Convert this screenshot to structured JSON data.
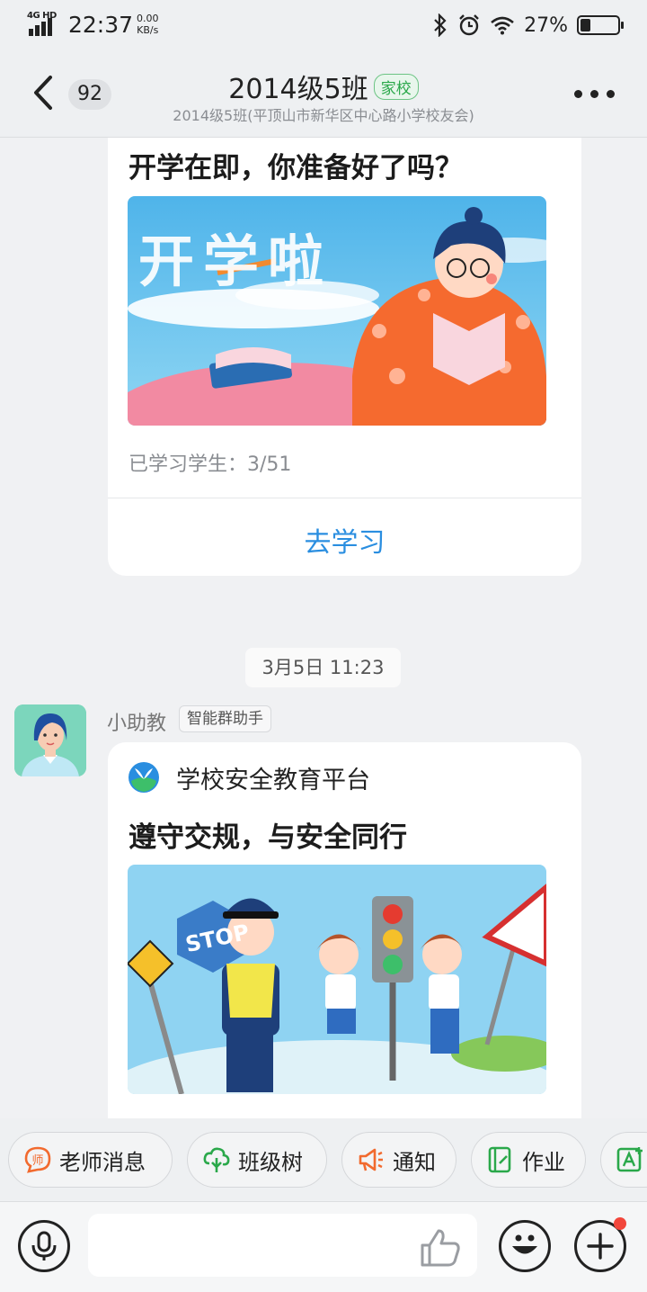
{
  "status_bar": {
    "network": "4G HD",
    "time": "22:37",
    "speed_value": "0.00",
    "speed_unit": "KB/s",
    "battery_percent": "27%",
    "battery_level": 0.27
  },
  "header": {
    "unread_count": "92",
    "title": "2014级5班",
    "title_tag": "家校",
    "subtitle": "2014级5班(平顶山市新华区中心路小学校友会)"
  },
  "messages": {
    "card1": {
      "title": "开学在即，你准备好了吗？",
      "image_text": "开学啦",
      "progress_label": "已学习学生：3/51",
      "action": "去学习"
    },
    "time_divider": "3月5日 11:23",
    "card2": {
      "sender": "小助教",
      "sender_tag": "智能群助手",
      "platform": "学校安全教育平台",
      "title": "遵守交规，与安全同行",
      "image_text": "STOP"
    }
  },
  "shortcuts": [
    {
      "label": "老师消息",
      "icon": "teacher-icon",
      "color": "#f26a2e"
    },
    {
      "label": "班级树",
      "icon": "tree-icon",
      "color": "#2aa84a"
    },
    {
      "label": "通知",
      "icon": "megaphone-icon",
      "color": "#f26a2e"
    },
    {
      "label": "作业",
      "icon": "homework-icon",
      "color": "#2aa84a"
    },
    {
      "label": "",
      "icon": "text-add-icon",
      "color": "#2aa84a"
    }
  ],
  "input": {
    "placeholder": ""
  },
  "colors": {
    "accent_blue": "#2a8ee0",
    "accent_green": "#2aa84a",
    "badge_red": "#f2463b"
  }
}
